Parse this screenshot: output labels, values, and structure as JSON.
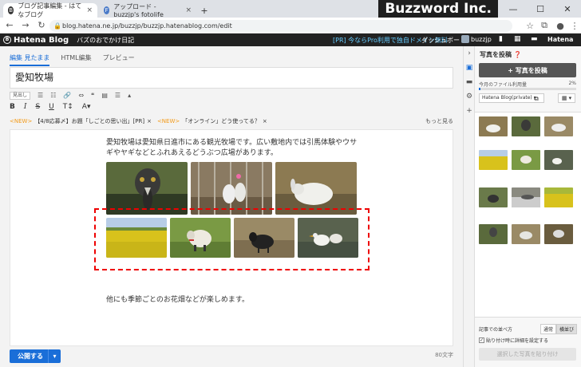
{
  "browser": {
    "tabs": [
      {
        "label": "ブログ記事編集 - はてなブログ",
        "active": true
      },
      {
        "label": "アップロード - buzzjp's fotolife",
        "active": false
      }
    ],
    "new_tab": "+",
    "brand_overlay": "Buzzword Inc.",
    "url": "blog.hatena.ne.jp/buzzjp/buzzjp.hatenablog.com/edit"
  },
  "hatena_bar": {
    "logo": "Hatena Blog",
    "blog_name": "バズのおでかけ日記",
    "pr_text": "[PR] 今ならPro利用で独自ドメイン無料",
    "dashboard": "ダッシュボード",
    "user": "buzzjp",
    "hatena": "Hatena"
  },
  "editor": {
    "tabs": [
      "編集 見たまま",
      "HTML編集",
      "プレビュー"
    ],
    "title": "愛知牧場",
    "format_select": "見出し",
    "news": [
      {
        "badge": "<NEW>",
        "text": "【4/8応募〆】お題「しごとの思い出」[PR]"
      },
      {
        "badge": "<NEW>",
        "text": "「オンライン」どう使ってる？"
      }
    ],
    "news_more": "もっと見る",
    "body_text_1": "愛知牧場は愛知県日進市にある観光牧場です。広い敷地内では引馬体験やウサギやヤギなどとふれあえるどうぶつ広場があります。",
    "body_text_2": "他にも季節ごとのお花畑などが楽しめます。",
    "publish_label": "公開する",
    "char_count": "80文字"
  },
  "side_panel": {
    "title": "写真を投稿",
    "post_button": "写真を投稿",
    "usage_label": "今月のファイル利用量",
    "usage_pct": "2%",
    "usage_fraction": 0.02,
    "folder": "Hatena Blog(private)",
    "order_label": "記事での並べ方",
    "order_options": [
      "通常",
      "横並び"
    ],
    "detail_checkbox": "貼り付け時に詳細を設定する",
    "paste_button": "選択した写真を貼り付け"
  },
  "colors": {
    "accent": "#1a6ed8",
    "new_badge": "#f39a17",
    "selection": "#ee0000"
  }
}
